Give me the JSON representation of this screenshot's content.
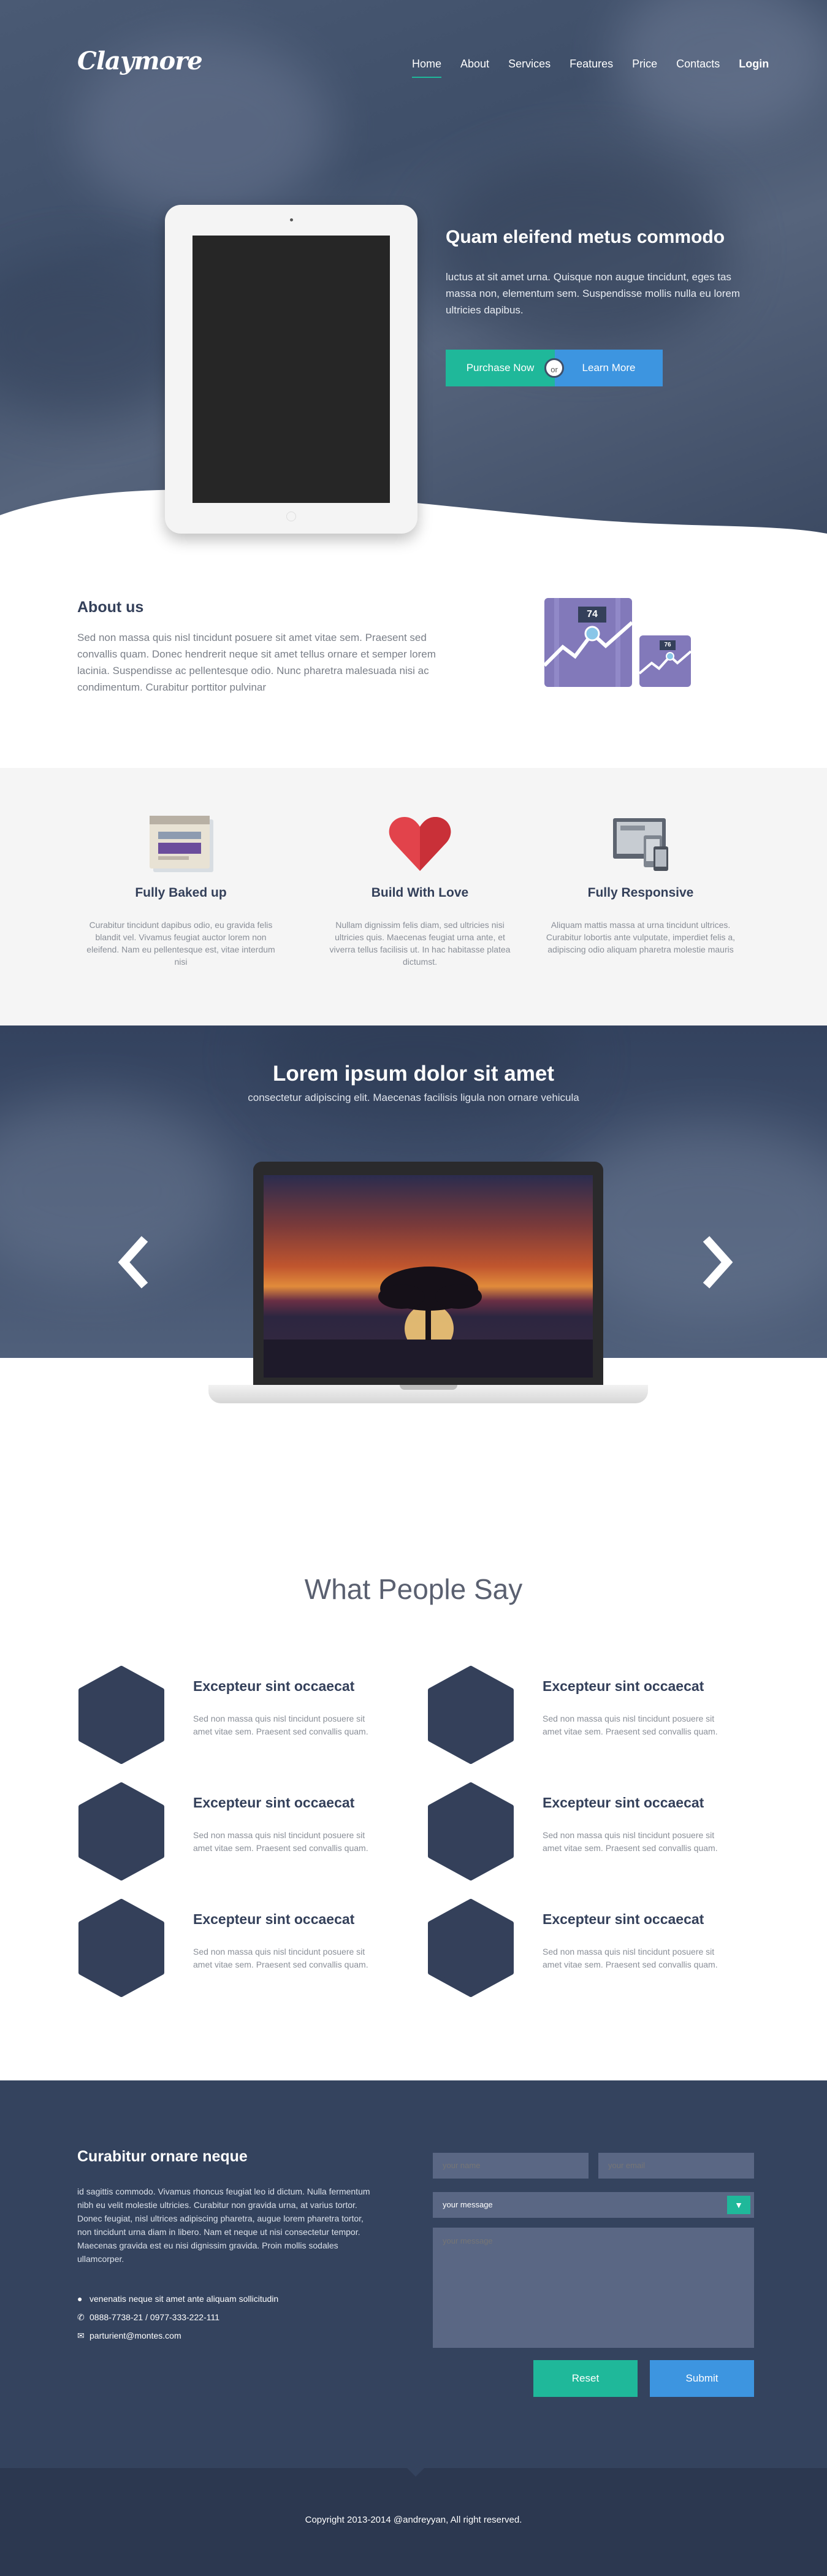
{
  "brand": {
    "logo": "Claymore"
  },
  "nav": {
    "items": [
      "Home",
      "About",
      "Services",
      "Features",
      "Price",
      "Contacts"
    ],
    "login": "Login"
  },
  "hero": {
    "title": "Quam eleifend metus commodo",
    "text": "luctus at sit amet urna. Quisque non augue tincidunt, eges tas massa non, elementum sem. Suspendisse mollis nulla eu lorem ultricies dapibus.",
    "purchase_label": "Purchase Now",
    "or_label": "or",
    "learn_label": "Learn More"
  },
  "about": {
    "title": "About us",
    "text": "Sed non massa quis nisl tincidunt posuere sit amet vitae sem. Praesent sed convallis quam. Donec hendrerit neque sit amet tellus ornare et semper lorem lacinia. Suspendisse ac pellentesque odio. Nunc pharetra malesuada nisi ac condimentum. Curabitur porttitor pulvinar",
    "stat_big": "74",
    "stat_small": "76"
  },
  "features": [
    {
      "icon": "browser-window-icon",
      "title": "Fully Baked up",
      "text": "Curabitur tincidunt dapibus odio, eu gravida felis blandit vel. Vivamus feugiat auctor lorem non eleifend. Nam eu pellentesque est, vitae interdum nisi"
    },
    {
      "icon": "heart-icon",
      "title": "Build With Love",
      "text": "Nullam dignissim felis diam, sed ultricies nisi ultricies quis. Maecenas feugiat urna ante, et viverra tellus facilisis ut. In hac habitasse platea dictumst."
    },
    {
      "icon": "devices-icon",
      "title": "Fully Responsive",
      "text": "Aliquam mattis massa at urna tincidunt ultrices. Curabitur lobortis ante vulputate, imperdiet felis a, adipiscing odio aliquam pharetra molestie mauris"
    }
  ],
  "slider": {
    "title": "Lorem ipsum dolor sit amet",
    "subtitle": "consectetur adipiscing elit. Maecenas facilisis ligula non ornare vehicula",
    "prev_icon": "chevron-left-icon",
    "next_icon": "chevron-right-icon"
  },
  "testimonials": {
    "title": "What People Say",
    "items": [
      {
        "name": "Excepteur sint occaecat",
        "text": "Sed non massa quis nisl tincidunt posuere sit amet vitae sem. Praesent sed convallis quam."
      },
      {
        "name": "Excepteur sint occaecat",
        "text": "Sed non massa quis nisl tincidunt posuere sit amet vitae sem. Praesent sed convallis quam."
      },
      {
        "name": "Excepteur sint occaecat",
        "text": "Sed non massa quis nisl tincidunt posuere sit amet vitae sem. Praesent sed convallis quam."
      },
      {
        "name": "Excepteur sint occaecat",
        "text": "Sed non massa quis nisl tincidunt posuere sit amet vitae sem. Praesent sed convallis quam."
      },
      {
        "name": "Excepteur sint occaecat",
        "text": "Sed non massa quis nisl tincidunt posuere sit amet vitae sem. Praesent sed convallis quam."
      },
      {
        "name": "Excepteur sint occaecat",
        "text": "Sed non massa quis nisl tincidunt posuere sit amet vitae sem. Praesent sed convallis quam."
      }
    ]
  },
  "contact": {
    "title": "Curabitur ornare neque",
    "text": "id sagittis commodo. Vivamus rhoncus feugiat leo id dictum. Nulla fermentum nibh eu velit molestie ultricies. Curabitur non gravida urna, at varius tortor. Donec feugiat, nisl ultrices adipiscing pharetra, augue lorem pharetra tortor, non tincidunt urna diam in libero. Nam et neque ut nisi consectetur tempor. Maecenas gravida est eu nisi dignissim gravida. Proin mollis sodales ullamcorper.",
    "address": "venenatis neque sit amet ante aliquam sollicitudin",
    "phone": "0888-7738-21 / 0977-333-222-111",
    "email": "parturient@montes.com",
    "name_placeholder": "your name",
    "email_placeholder": "your email",
    "select_value": "your message",
    "message_placeholder": "your message",
    "reset_label": "Reset",
    "submit_label": "Submit"
  },
  "footer": {
    "copyright": "Copyright 2013-2014 @andreyyan, All right reserved."
  },
  "colors": {
    "accent_green": "#1fb89a",
    "accent_blue": "#3d95e0",
    "navy": "#34435e",
    "purple": "#8279ba",
    "heart_red": "#e2434b"
  }
}
